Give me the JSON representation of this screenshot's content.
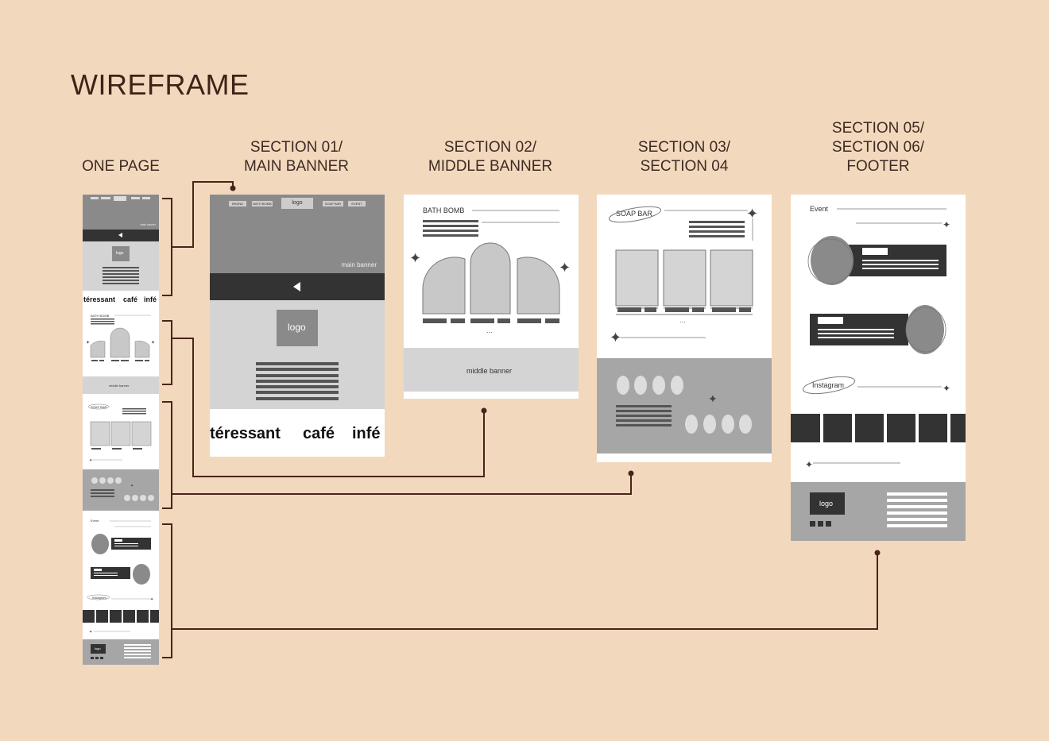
{
  "title": "WIREFRAME",
  "columns": {
    "one_page": [
      "ONE PAGE"
    ],
    "s01": [
      "SECTION 01/",
      "MAIN BANNER"
    ],
    "s02": [
      "SECTION 02/",
      "MIDDLE BANNER"
    ],
    "s03": [
      "SECTION 03/",
      "SECTION 04"
    ],
    "s05": [
      "SECTION 05/",
      "SECTION 06/",
      "FOOTER"
    ]
  },
  "s01": {
    "nav": [
      "BRAND",
      "BATH BOMB",
      "logo",
      "SOAP BAR",
      "EVENT"
    ],
    "banner_label": "main banner",
    "logo": "logo",
    "marquee": [
      "téressant",
      "café",
      "infé"
    ]
  },
  "s02": {
    "heading": "BATH BOMB",
    "ellipsis": "...",
    "middle_banner": "middle banner"
  },
  "s03": {
    "heading": "SOAP BAR",
    "ellipsis": "..."
  },
  "s05": {
    "event": "Event",
    "instagram": "Instagram",
    "logo": "logo"
  },
  "mini": {
    "banner_label": "main banner",
    "logo": "logo",
    "marquee": [
      "téressant",
      "café",
      "infé"
    ],
    "bath_bomb": "BATH BOMB",
    "middle_banner": "middle banner",
    "soap_bar": "SOAP BAR",
    "ellipsis": "...",
    "event": "Event",
    "instagram": "Instagram"
  },
  "colors": {
    "background": "#f2d9be",
    "connector": "#4a2418",
    "dark": "#333333",
    "mid": "#8a8a8a",
    "light": "#d4d4d4"
  }
}
